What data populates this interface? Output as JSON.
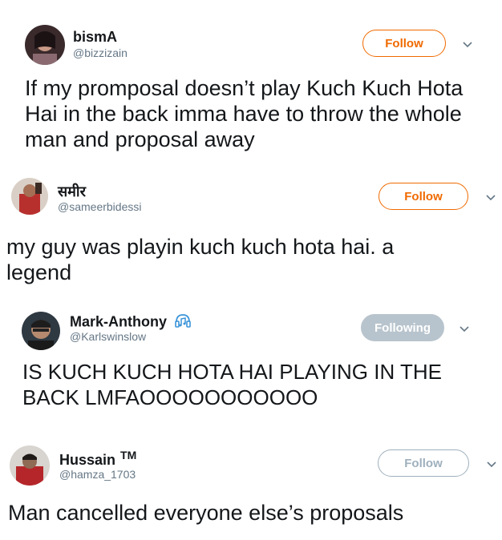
{
  "tweets": [
    {
      "name": "bismA",
      "handle": "@bizzizain",
      "follow_label": "Follow",
      "text": "If my promposal doesn’t play Kuch Kuch Hota Hai in the back imma have to throw the whole man and proposal away"
    },
    {
      "name": "समीर",
      "handle": "@sameerbidessi",
      "follow_label": "Follow",
      "text": "my guy was playin kuch kuch hota hai. a legend"
    },
    {
      "name": "Mark-Anthony",
      "handle": "@Karlswinslow",
      "follow_label": "Following",
      "text": "IS KUCH KUCH HOTA HAI PLAYING IN THE BACK LMFAOOOOOOOOOOO"
    },
    {
      "name": "Hussain",
      "name_suffix": "TM",
      "handle": "@hamza_1703",
      "follow_label": "Follow",
      "text": "Man cancelled everyone else’s proposals"
    }
  ],
  "colors": {
    "accent": "#f06a00",
    "following_bg": "#b8c4cd",
    "muted": "#9fb0bd",
    "handle": "#657786"
  },
  "icons": [
    "chevron-down-icon",
    "headphones-icon"
  ]
}
